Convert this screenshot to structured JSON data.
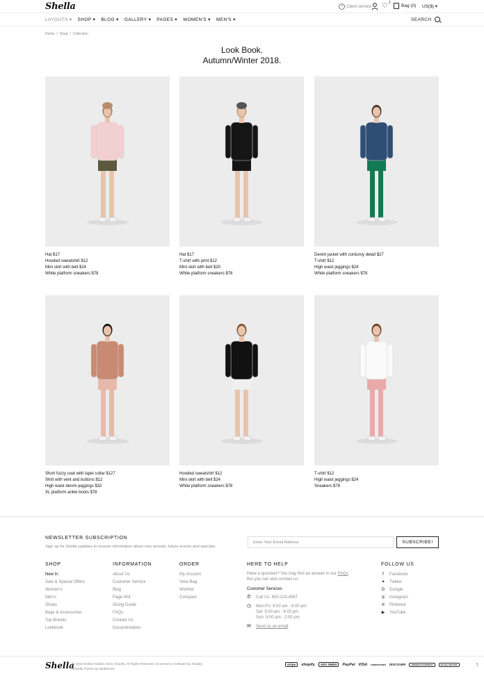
{
  "header": {
    "logo": "Shella",
    "client_service": "Client service",
    "wishlist_count": "1",
    "bag": "Bag (0)",
    "currency": "US($) ▾"
  },
  "nav": {
    "items": [
      "LAYOUTS ▾",
      "SHOP ▾",
      "BLOG ▾",
      "GALLERY ▾",
      "PAGES ▾",
      "WOMEN'S ▾",
      "MEN'S ▾"
    ],
    "search": "SEARCH"
  },
  "breadcrumb": [
    "Home",
    "/",
    "Shop",
    "/",
    "Collection"
  ],
  "page": {
    "title_line1": "Look Book.",
    "title_line2": "Autumn/Winter 2018."
  },
  "looks": [
    {
      "items": [
        "Hat  $17",
        "Hooded sweatshirt  $12",
        "Mini skirt with belt  $24",
        "White platform sneakers $78"
      ],
      "top_color": "#f2cfd0",
      "bottom_color": "#5b5a3f",
      "hair_color": "#9c7a56",
      "hat_color": "#b98d6b"
    },
    {
      "items": [
        "Hat  $17",
        "T-shirt with print  $12",
        "Mini skirt with belt  $20",
        "White platform sneakers $78"
      ],
      "top_color": "#151515",
      "bottom_color": "#151515",
      "hair_color": "#b79a6a",
      "hat_color": "#555555"
    },
    {
      "items": [
        "Denim jacket with corduroy detail  $27",
        "T-shirt  $12",
        "High waist jeggings  $24",
        "White platform sneakers $78"
      ],
      "top_color": "#2f4e75",
      "bottom_color": "#127a52",
      "hair_color": "#4a3426",
      "hat_color": ""
    },
    {
      "items": [
        "Short fuzzy coat with lapel collar  $127",
        "Shirt with vent and buttons  $12",
        "High waist denim jeggings $32",
        "XL platform ankle boots $78"
      ],
      "top_color": "#c98a73",
      "bottom_color": "#e8b9aa",
      "hair_color": "#1c120c",
      "hat_color": ""
    },
    {
      "items": [
        "Hooded sweatshirt  $12",
        "Mini skirt with belt  $24",
        "White platform sneakers $78"
      ],
      "top_color": "#111111",
      "bottom_color": "#f0f0f0",
      "hair_color": "#7a5133",
      "hat_color": ""
    },
    {
      "items": [
        "T-shirt  $12",
        "High waist jeggings  $24",
        "Sneakers $78"
      ],
      "top_color": "#fafafa",
      "bottom_color": "#e9a9ab",
      "hair_color": "#6b3c25",
      "hat_color": ""
    }
  ],
  "newsletter": {
    "title": "NEWSLETTER SUBSCRIPTION",
    "desc": "Sign up for Shella updates to receive information about new arrivals, future events and specials.",
    "placeholder": "Enter Your Email Address",
    "button": "SUBSCRIBE!"
  },
  "footer": {
    "shop": {
      "title": "SHOP",
      "items": [
        "New In",
        "Sale & Special Offers",
        "Women's",
        "Men's",
        "Shoes",
        "Bags & Accessories",
        "Top Brands",
        "Lookbook"
      ]
    },
    "information": {
      "title": "INFORMATION",
      "items": [
        "About Us",
        "Customer Service",
        "Blog",
        "Page 404",
        "Sizing Guide",
        "FAQs",
        "Contact Us",
        "Documentation"
      ]
    },
    "order": {
      "title": "ORDER",
      "items": [
        "My Account",
        "View Bag",
        "Wishlist",
        "Compare"
      ]
    },
    "help": {
      "title": "HERE TO HELP",
      "text1": "Have a question? You may find an answer in our",
      "faq_link": "FAQs",
      "text2": "But you can also contact us:",
      "cs_label": "Customer Services",
      "phone": "Call Us: 800-123-4567",
      "hours": [
        "Mon-Fri: 9:00 am - 6:00 pm",
        "Sat: 9:00 am - 4:00 pm",
        "Sun: 9:00 am - 2:00 pm"
      ],
      "email": "Send us an email"
    },
    "follow": {
      "title": "FOLLOW US",
      "items": [
        "Facebook",
        "Twitter",
        "Google",
        "Instagram",
        "Pinterest",
        "YouTube"
      ]
    }
  },
  "bottom": {
    "logo": "Shella",
    "copyright1": "© 2018 Shella Fashion Store Shopify. All Rights Reserved. Ecommerce Software by Shopify.",
    "copyright2": "Shopify Theme by Mpithemes."
  },
  "payments": [
    "stripe",
    "shopify",
    "AES 256bit",
    "PayPal",
    "VISA",
    "mastercard",
    "DISCOVER",
    "AMERICAN EXPRESS",
    "McAfee SECURE"
  ]
}
